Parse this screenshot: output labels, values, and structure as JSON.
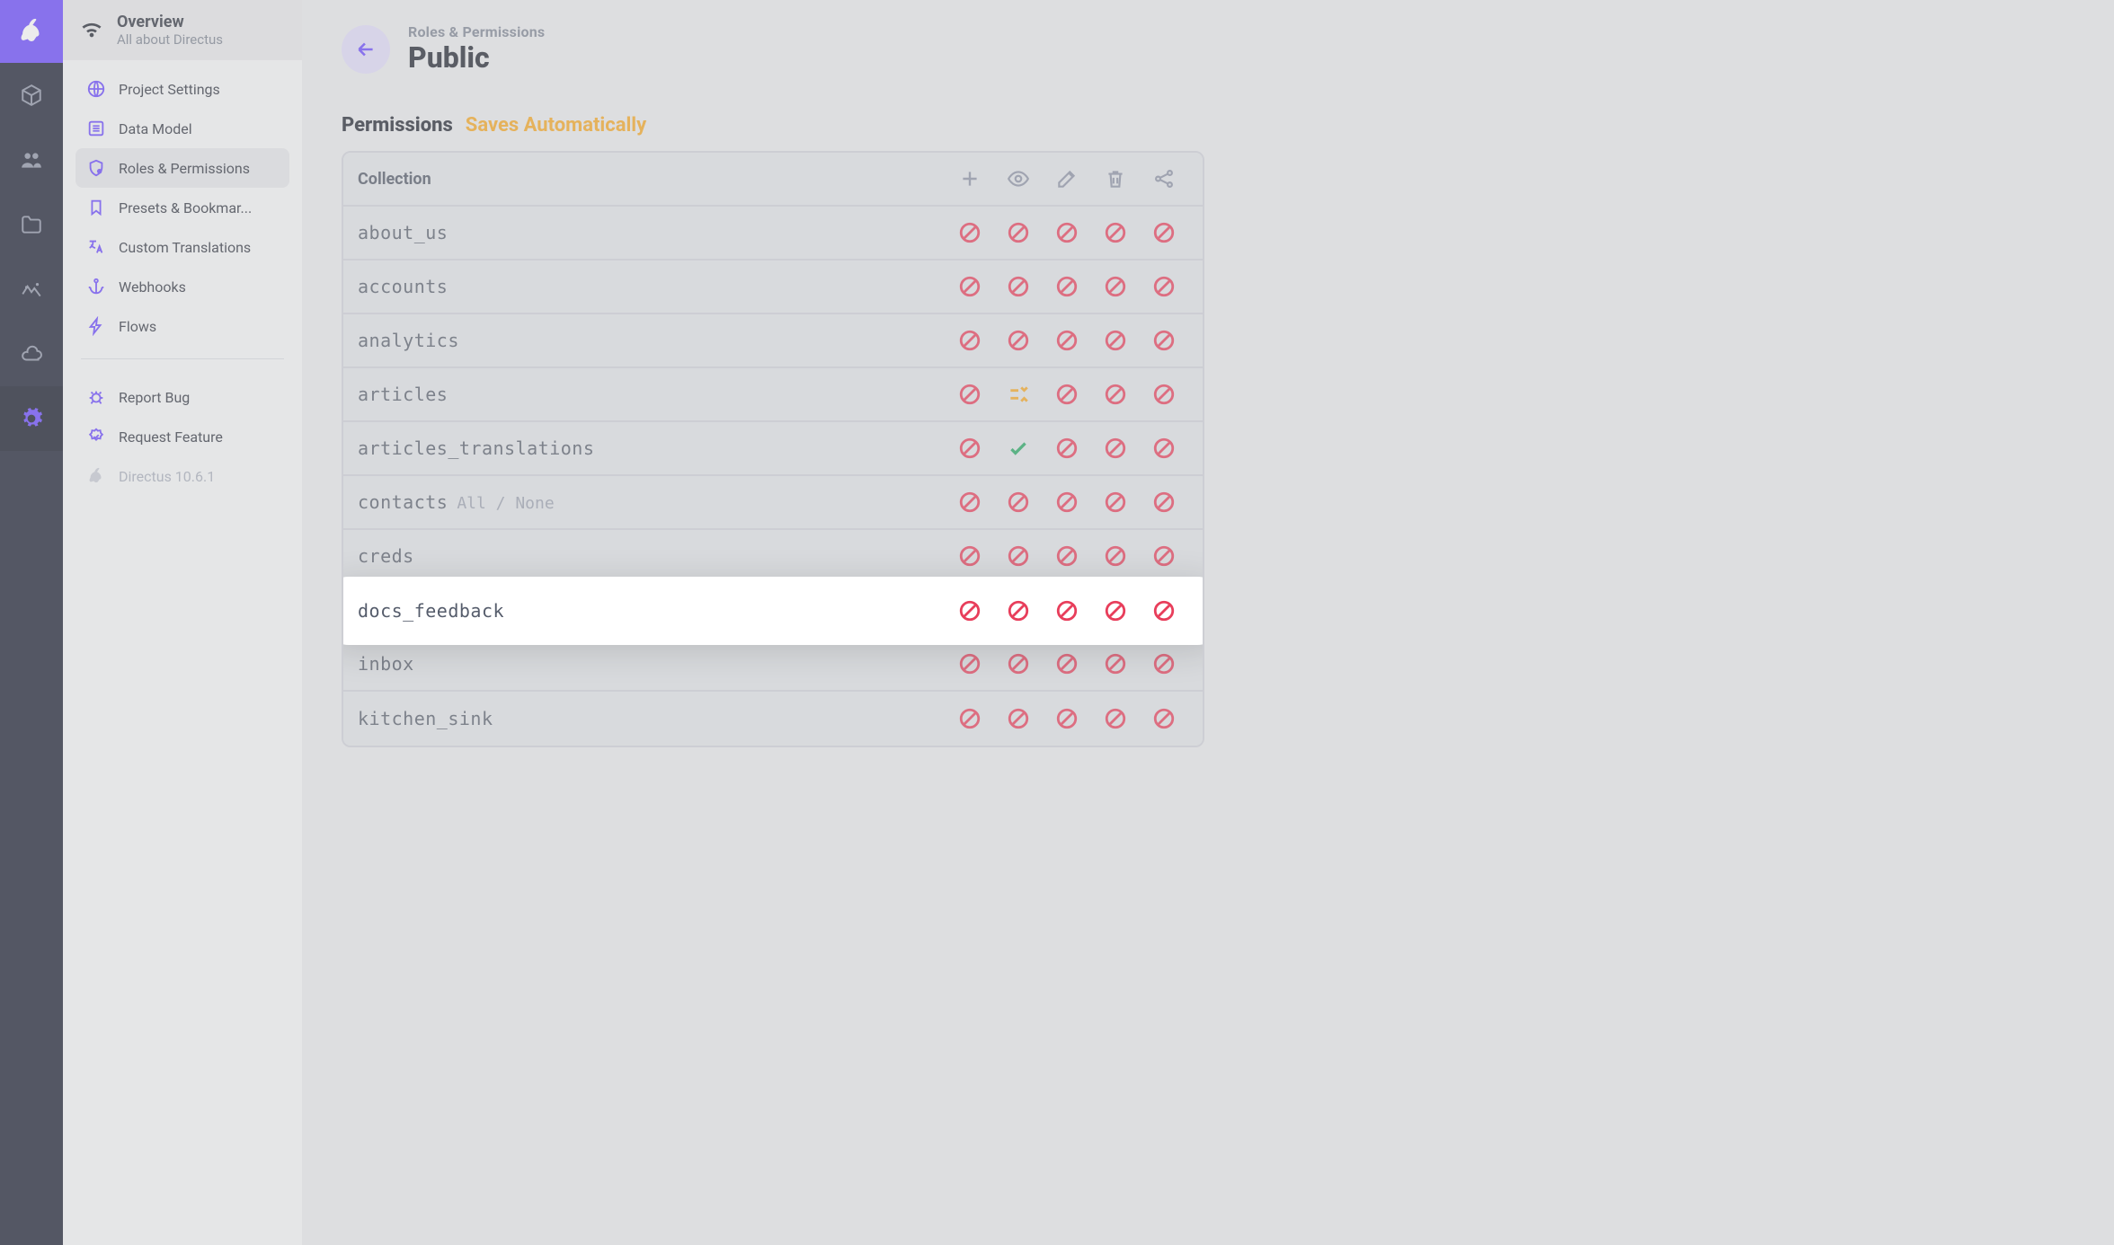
{
  "modulebar": {
    "active_index": 5
  },
  "sidebar": {
    "header_title": "Overview",
    "header_subtitle": "All about Directus",
    "items": [
      {
        "label": "Project Settings",
        "icon": "globe"
      },
      {
        "label": "Data Model",
        "icon": "list"
      },
      {
        "label": "Roles & Permissions",
        "icon": "shield"
      },
      {
        "label": "Presets & Bookmar...",
        "icon": "bookmark"
      },
      {
        "label": "Custom Translations",
        "icon": "translate"
      },
      {
        "label": "Webhooks",
        "icon": "anchor"
      },
      {
        "label": "Flows",
        "icon": "bolt"
      }
    ],
    "footer_items": [
      {
        "label": "Report Bug",
        "icon": "bug"
      },
      {
        "label": "Request Feature",
        "icon": "badge"
      }
    ],
    "version_label": "Directus 10.6.1",
    "active_index": 2
  },
  "page": {
    "pretitle": "Roles & Permissions",
    "title": "Public"
  },
  "section": {
    "title": "Permissions",
    "badge": "Saves Automatically"
  },
  "table": {
    "header_label": "Collection",
    "header_icons": [
      "plus",
      "eye",
      "pencil",
      "trash",
      "share"
    ],
    "states": {
      "deny": "deny",
      "allow": "allow",
      "custom": "custom"
    },
    "rows": [
      {
        "name": "about_us",
        "actions": null,
        "cells": [
          "deny",
          "deny",
          "deny",
          "deny",
          "deny"
        ],
        "highlight": false
      },
      {
        "name": "accounts",
        "actions": null,
        "cells": [
          "deny",
          "deny",
          "deny",
          "deny",
          "deny"
        ],
        "highlight": false
      },
      {
        "name": "analytics",
        "actions": null,
        "cells": [
          "deny",
          "deny",
          "deny",
          "deny",
          "deny"
        ],
        "highlight": false
      },
      {
        "name": "articles",
        "actions": null,
        "cells": [
          "deny",
          "custom",
          "deny",
          "deny",
          "deny"
        ],
        "highlight": false
      },
      {
        "name": "articles_translations",
        "actions": null,
        "cells": [
          "deny",
          "allow",
          "deny",
          "deny",
          "deny"
        ],
        "highlight": false
      },
      {
        "name": "contacts",
        "actions": "All / None",
        "cells": [
          "deny",
          "deny",
          "deny",
          "deny",
          "deny"
        ],
        "highlight": false
      },
      {
        "name": "creds",
        "actions": null,
        "cells": [
          "deny",
          "deny",
          "deny",
          "deny",
          "deny"
        ],
        "highlight": false
      },
      {
        "name": "docs_feedback",
        "actions": null,
        "cells": [
          "deny",
          "deny",
          "deny",
          "deny",
          "deny"
        ],
        "highlight": true
      },
      {
        "name": "inbox",
        "actions": null,
        "cells": [
          "deny",
          "deny",
          "deny",
          "deny",
          "deny"
        ],
        "highlight": false
      },
      {
        "name": "kitchen_sink",
        "actions": null,
        "cells": [
          "deny",
          "deny",
          "deny",
          "deny",
          "deny"
        ],
        "highlight": false
      }
    ]
  }
}
